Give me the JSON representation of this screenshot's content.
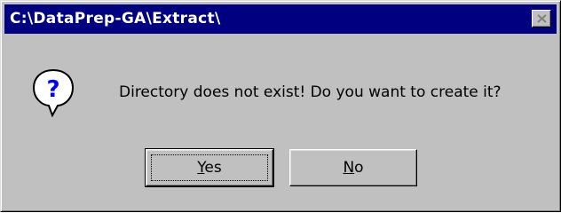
{
  "window": {
    "title": "C:\\DataPrep-GA\\Extract\\",
    "close_icon": "close-icon"
  },
  "message": {
    "icon": "question-icon",
    "text": "Directory does not exist!  Do you want to create it?"
  },
  "buttons": {
    "yes": {
      "accel": "Y",
      "rest": "es"
    },
    "no": {
      "accel": "N",
      "rest": "o"
    }
  },
  "colors": {
    "titlebar": "#000080",
    "face": "#c0c0c0",
    "icon_blue": "#0000ff"
  }
}
